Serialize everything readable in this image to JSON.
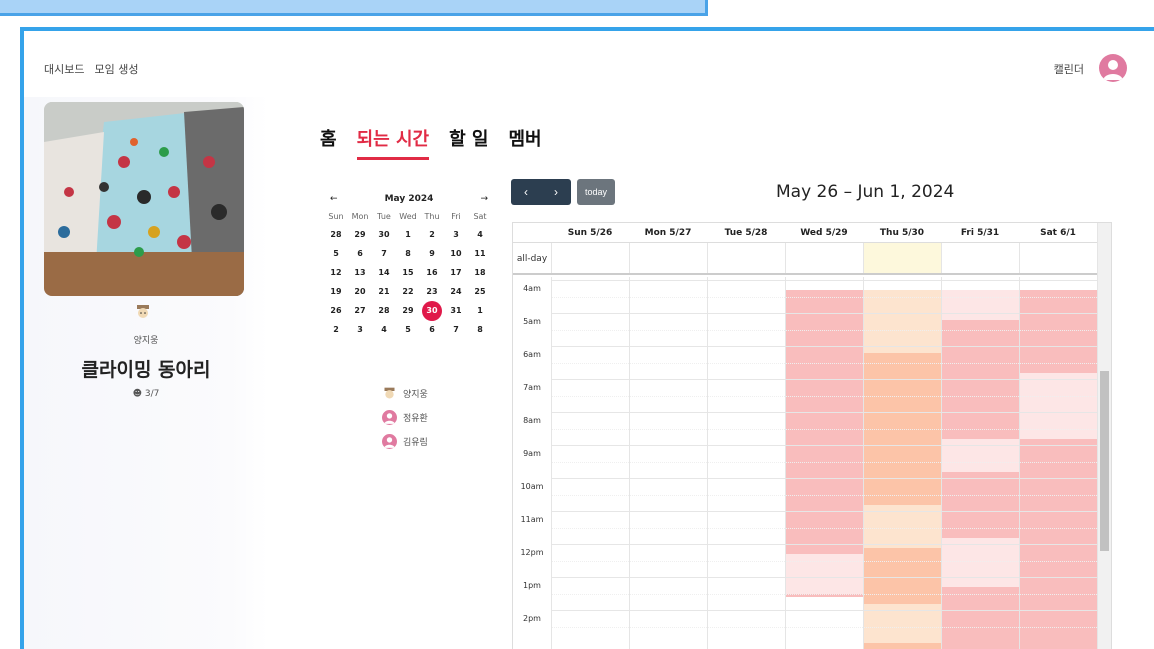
{
  "nav": {
    "dashboard": "대시보드",
    "create_group": "모임 생성",
    "calendar": "캘린더"
  },
  "group": {
    "owner": "양지웅",
    "title": "클라이밍 동아리",
    "member_count": "3/7"
  },
  "tabs": [
    {
      "label": "홈"
    },
    {
      "label": "되는 시간"
    },
    {
      "label": "할 일"
    },
    {
      "label": "멤버"
    }
  ],
  "active_tab": 1,
  "mini_calendar": {
    "month_label": "May 2024",
    "prev": "←",
    "next": "→",
    "weekdays": [
      "Sun",
      "Mon",
      "Tue",
      "Wed",
      "Thu",
      "Fri",
      "Sat"
    ],
    "weeks": [
      [
        "28",
        "29",
        "30",
        "1",
        "2",
        "3",
        "4"
      ],
      [
        "5",
        "6",
        "7",
        "8",
        "9",
        "10",
        "11"
      ],
      [
        "12",
        "13",
        "14",
        "15",
        "16",
        "17",
        "18"
      ],
      [
        "19",
        "20",
        "21",
        "22",
        "23",
        "24",
        "25"
      ],
      [
        "26",
        "27",
        "28",
        "29",
        "30",
        "31",
        "1"
      ],
      [
        "2",
        "3",
        "4",
        "5",
        "6",
        "7",
        "8"
      ]
    ],
    "today": "30"
  },
  "members": [
    {
      "name": "양지웅"
    },
    {
      "name": "정유환"
    },
    {
      "name": "김유림"
    }
  ],
  "week_calendar": {
    "prev": "‹",
    "next": "›",
    "today_label": "today",
    "title": "May 26 – Jun 1, 2024",
    "all_day_label": "all-day",
    "days": [
      "Sun 5/26",
      "Mon 5/27",
      "Tue 5/28",
      "Wed 5/29",
      "Thu 5/30",
      "Fri 5/31",
      "Sat 6/1"
    ],
    "today_index": 4,
    "hours": [
      "4am",
      "5am",
      "6am",
      "7am",
      "8am",
      "9am",
      "10am",
      "11am",
      "12pm",
      "1pm",
      "2pm"
    ],
    "colors": {
      "light": "#fde6e6",
      "medium": "#fbcccc",
      "strong": "#f9bdbd",
      "peach": "#fde4cf",
      "orange": "#fcc4a8",
      "today_bg": "#fdf8dc"
    },
    "availability": [
      {
        "day": 3,
        "start": 4,
        "end": 15.8,
        "tone": "strong"
      },
      {
        "day": 3,
        "start": 12,
        "end": 13.2,
        "tone": "light"
      },
      {
        "day": 3,
        "start": 13.3,
        "end": 15.8,
        "tone": "none"
      },
      {
        "day": 4,
        "start": 4,
        "end": 5.9,
        "tone": "peach"
      },
      {
        "day": 4,
        "start": 5.9,
        "end": 10.5,
        "tone": "orange"
      },
      {
        "day": 4,
        "start": 10.5,
        "end": 11.8,
        "tone": "peach"
      },
      {
        "day": 4,
        "start": 11.8,
        "end": 13.5,
        "tone": "orange"
      },
      {
        "day": 4,
        "start": 13.5,
        "end": 14.7,
        "tone": "peach"
      },
      {
        "day": 4,
        "start": 14.7,
        "end": 15.8,
        "tone": "orange"
      },
      {
        "day": 5,
        "start": 4,
        "end": 4.9,
        "tone": "light"
      },
      {
        "day": 5,
        "start": 4.9,
        "end": 8.5,
        "tone": "strong"
      },
      {
        "day": 5,
        "start": 8.5,
        "end": 9.5,
        "tone": "light"
      },
      {
        "day": 5,
        "start": 9.5,
        "end": 11.5,
        "tone": "strong"
      },
      {
        "day": 5,
        "start": 11.5,
        "end": 13,
        "tone": "light"
      },
      {
        "day": 5,
        "start": 13,
        "end": 15.8,
        "tone": "strong"
      },
      {
        "day": 6,
        "start": 4,
        "end": 6.5,
        "tone": "strong"
      },
      {
        "day": 6,
        "start": 6.5,
        "end": 8.5,
        "tone": "light"
      },
      {
        "day": 6,
        "start": 8.5,
        "end": 15.8,
        "tone": "strong"
      }
    ]
  }
}
